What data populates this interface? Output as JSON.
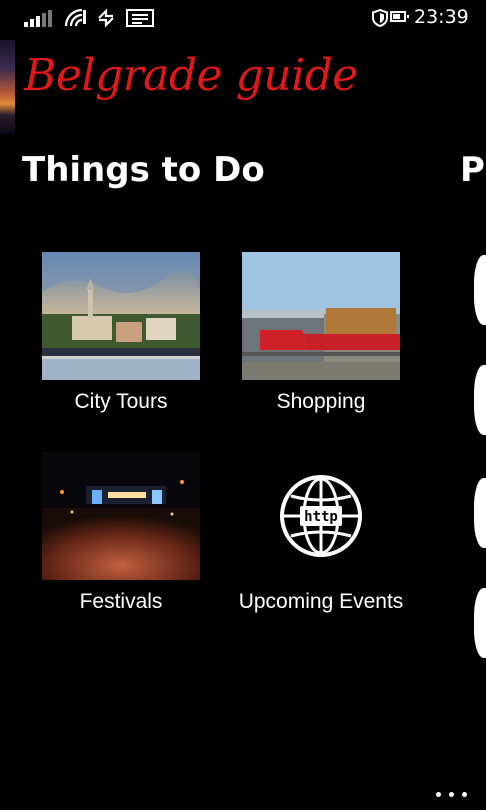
{
  "status_bar": {
    "time": "23:39"
  },
  "app": {
    "title": "Belgrade guide",
    "title_color": "#e01818"
  },
  "section": {
    "title": "Things to Do",
    "next_title_peek": "Pl"
  },
  "tiles": [
    {
      "label": "City Tours",
      "icon": "city-photo"
    },
    {
      "label": "Shopping",
      "icon": "mall-photo"
    },
    {
      "label": "Festivals",
      "icon": "festival-photo"
    },
    {
      "label": "Upcoming Events",
      "icon": "globe-http-icon"
    }
  ],
  "globe_text": "http",
  "app_bar": {
    "more_icon": "ellipsis-icon"
  }
}
